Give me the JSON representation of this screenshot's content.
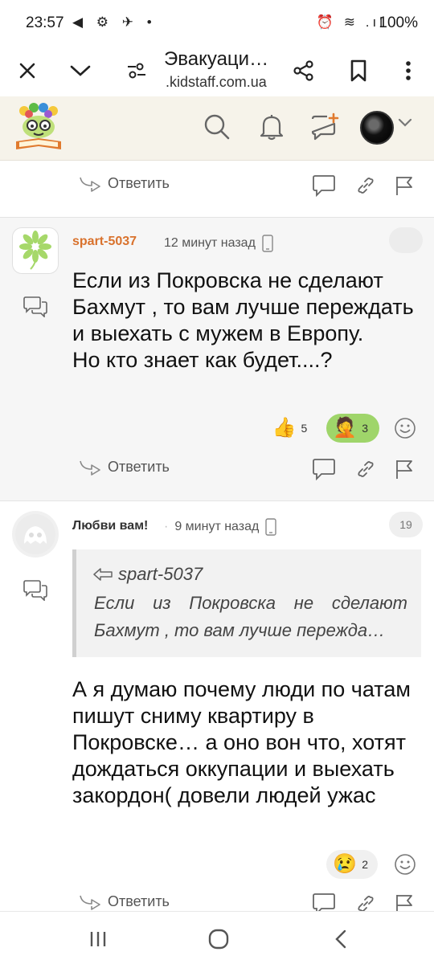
{
  "status": {
    "time": "23:57",
    "left_icons": "◀ ⚙ ✈ •",
    "right_icons": "⏰ ≋ .ıl",
    "battery": "100%"
  },
  "browser": {
    "title": "Эвакуаци…",
    "url": ".kidstaff.com.ua"
  },
  "top_action": {
    "reply_label": "Ответить"
  },
  "post1": {
    "author": "spart-5037",
    "time": "12 минут назад",
    "body": "Если из Покровска не сделают Бахмут , то вам лучше переждать и выехать с мужем в Европу.\nНо кто знает как будет....?",
    "reactions": [
      {
        "emoji": "👍",
        "count": "5"
      },
      {
        "emoji": "🤦",
        "count": "3"
      }
    ],
    "reply_label": "Ответить"
  },
  "post2": {
    "author": "Любви вам!",
    "time": "9 минут назад",
    "badge": "19",
    "quote_author": "spart-5037",
    "quote_text": "Если из Покровска не сделают Бахмут , то вам лучше пережда…",
    "body": "А я думаю почему люди по чатам пишут сниму квартиру в Покровске… а оно вон что, хотят дождаться оккупации и выехать закордон( довели людей ужас",
    "reactions": [
      {
        "emoji": "😢",
        "count": "2"
      }
    ],
    "reply_label": "Ответить"
  },
  "colors": {
    "accent": "#d9722d",
    "header_bg": "#f6f3ea",
    "reaction_active": "#9fd56a"
  }
}
